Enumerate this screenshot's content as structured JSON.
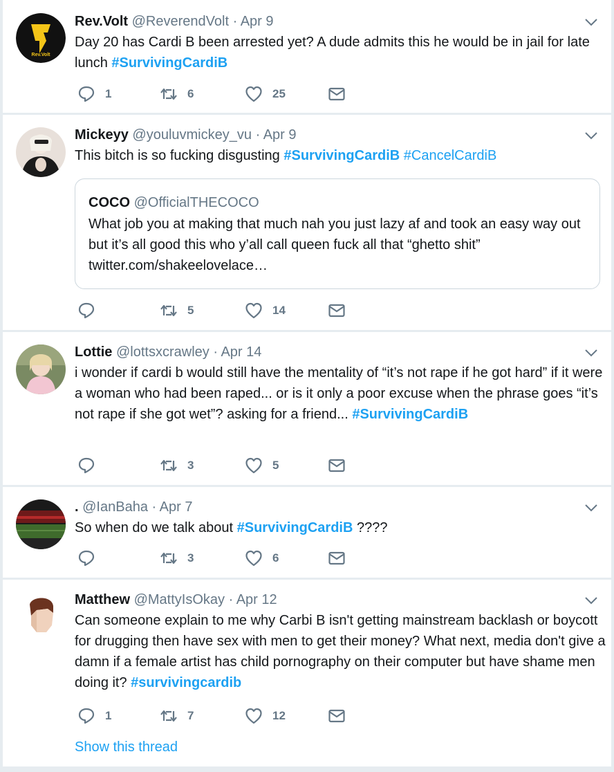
{
  "tweets": [
    {
      "name": "Rev.Volt",
      "handle": "@ReverendVolt",
      "sep": "·",
      "date": "Apr 9",
      "text_parts": [
        "Day 20 has Cardi B been arrested yet? A dude admits this he would be in jail for late lunch ",
        "#SurvivingCardiB"
      ],
      "reply_count": "1",
      "retweet_count": "6",
      "like_count": "25",
      "avatar_text": "Rev.Volt"
    },
    {
      "name": "Mickeyy",
      "handle": "@youluvmickey_vu",
      "sep": "·",
      "date": "Apr 9",
      "text_parts": [
        "This bitch is so fucking disgusting ",
        "#SurvivingCardiB",
        " ",
        "#CancelCardiB"
      ],
      "reply_count": "",
      "retweet_count": "5",
      "like_count": "14",
      "quote": {
        "name": "COCO",
        "handle": "@OfficialTHECOCO",
        "text": "What job you at making that much nah you just lazy af and took an easy way out but it’s all good this who y’all call queen fuck all that “ghetto shit” twitter.com/shakeelovelace…"
      }
    },
    {
      "name": "Lottie",
      "handle": "@lottsxcrawley",
      "sep": "·",
      "date": "Apr 14",
      "text_parts": [
        "i wonder if cardi b would still have the mentality of “it’s not rape if he got hard” if it were a woman who had been raped... or is it only a poor excuse when the phrase goes “it’s not rape if she got wet”? asking for a friend... ",
        "#SurvivingCardiB"
      ],
      "reply_count": "",
      "retweet_count": "3",
      "like_count": "5"
    },
    {
      "name": ".",
      "handle": "@IanBaha",
      "sep": "·",
      "date": "Apr 7",
      "text_parts": [
        "So when do we talk about ",
        "#SurvivingCardiB",
        " ????"
      ],
      "reply_count": "",
      "retweet_count": "3",
      "like_count": "6"
    },
    {
      "name": "Matthew",
      "handle": "@MattyIsOkay",
      "sep": "·",
      "date": "Apr 12",
      "text_parts": [
        "Can someone explain to me why Carbi B isn't getting mainstream backlash or boycott for drugging then have sex with men to get their money? What next, media don't give a damn if a female artist has child pornography on their computer but have shame men doing it? ",
        "#survivingcardib"
      ],
      "reply_count": "1",
      "retweet_count": "7",
      "like_count": "12",
      "show_thread": "Show this thread"
    }
  ],
  "colors": {
    "link": "#1da1f2",
    "muted": "#657786",
    "text": "#14171a",
    "bg": "#e6ecf0"
  },
  "icons": [
    "reply-icon",
    "retweet-icon",
    "like-icon",
    "message-icon",
    "chevron-down-icon"
  ]
}
